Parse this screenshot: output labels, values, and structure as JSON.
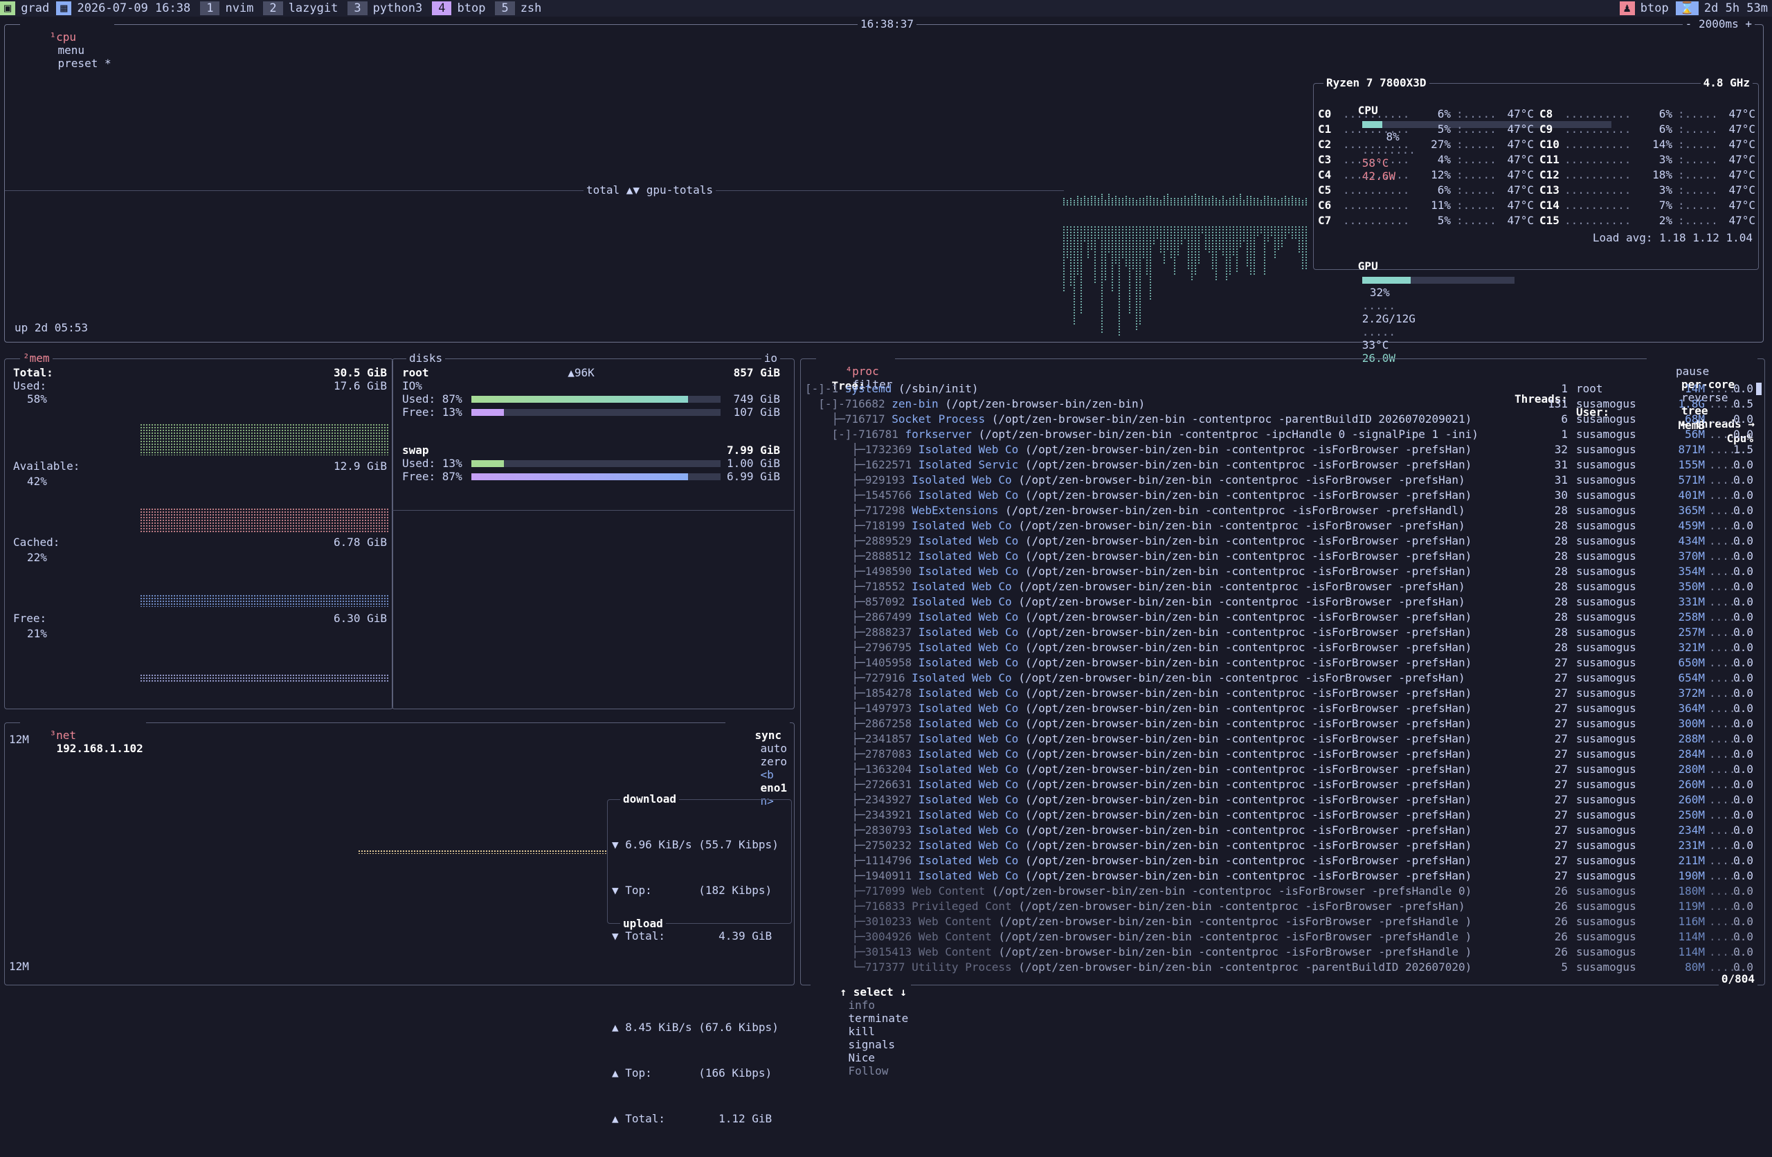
{
  "topbar": {
    "host": "grad",
    "datetime": "2026-07-09 16:38",
    "workspaces": [
      {
        "num": "1",
        "name": "nvim"
      },
      {
        "num": "2",
        "name": "lazygit"
      },
      {
        "num": "3",
        "name": "python3"
      },
      {
        "num": "4",
        "name": "btop"
      },
      {
        "num": "5",
        "name": "zsh"
      }
    ],
    "active_app": "btop",
    "uptime": "2d 5h 53m"
  },
  "cpu_panel": {
    "title": "¹cpu",
    "menu": "menu",
    "preset": "preset *",
    "clock": "16:38:37",
    "interval": "- 2000ms +",
    "graph_label": "total ▲▼ gpu-totals",
    "uptime": "up 2d 05:53",
    "model": "Ryzen 7 7800X3D",
    "freq": "4.8 GHz",
    "cpu_total": {
      "label": "CPU",
      "pct": "8%",
      "temp": "58°C",
      "power": "42.6W",
      "value": 0.08
    },
    "cores_left": [
      {
        "id": "C0",
        "pct": "6%",
        "temp": "47°C"
      },
      {
        "id": "C1",
        "pct": "5%",
        "temp": "47°C"
      },
      {
        "id": "C2",
        "pct": "27%",
        "temp": "47°C"
      },
      {
        "id": "C3",
        "pct": "4%",
        "temp": "47°C"
      },
      {
        "id": "C4",
        "pct": "12%",
        "temp": "47°C"
      },
      {
        "id": "C5",
        "pct": "6%",
        "temp": "47°C"
      },
      {
        "id": "C6",
        "pct": "11%",
        "temp": "47°C"
      },
      {
        "id": "C7",
        "pct": "5%",
        "temp": "47°C"
      }
    ],
    "cores_right": [
      {
        "id": "C8",
        "pct": "6%",
        "temp": "47°C"
      },
      {
        "id": "C9",
        "pct": "6%",
        "temp": "47°C"
      },
      {
        "id": "C10",
        "pct": "14%",
        "temp": "47°C"
      },
      {
        "id": "C11",
        "pct": "3%",
        "temp": "47°C"
      },
      {
        "id": "C12",
        "pct": "18%",
        "temp": "47°C"
      },
      {
        "id": "C13",
        "pct": "3%",
        "temp": "47°C"
      },
      {
        "id": "C14",
        "pct": "7%",
        "temp": "47°C"
      },
      {
        "id": "C15",
        "pct": "2%",
        "temp": "47°C"
      }
    ],
    "load_avg": "Load avg: 1.18 1.12 1.04",
    "gpu": {
      "label": "GPU",
      "pct": "32%",
      "mem": "2.2G/12G",
      "temp": "33°C",
      "power": "26.0W",
      "value": 0.32
    }
  },
  "mem_panel": {
    "title": "²mem",
    "total_label": "Total:",
    "total": "30.5 GiB",
    "used_label": "Used:",
    "used": "17.6 GiB",
    "used_pct": "58%",
    "avail_label": "Available:",
    "avail": "12.9 GiB",
    "avail_pct": "42%",
    "cached_label": "Cached:",
    "cached": "6.78 GiB",
    "cached_pct": "22%",
    "free_label": "Free:",
    "free": "6.30 GiB",
    "free_pct": "21%"
  },
  "disks_panel": {
    "title": "disks",
    "io_btn": "io",
    "root": {
      "name": "root",
      "speed": "▲96K",
      "size": "857 GiB",
      "io": "IO%",
      "used_label": "Used: 87%",
      "used": "749 GiB",
      "used_value": 0.87,
      "free_label": "Free: 13%",
      "free": "107 GiB",
      "free_value": 0.13
    },
    "swap": {
      "name": "swap",
      "size": "7.99 GiB",
      "used_label": "Used: 13%",
      "used": "1.00 GiB",
      "used_value": 0.13,
      "free_label": "Free: 87%",
      "free": "6.99 GiB",
      "free_value": 0.87
    }
  },
  "net_panel": {
    "title": "³net",
    "ip": "192.168.1.102",
    "sync": "sync",
    "auto": "auto",
    "zero": "zero",
    "prev": "<b",
    "iface": "eno1",
    "next": "n>",
    "scale_top": "12M",
    "scale_bottom": "12M",
    "download_label": "download",
    "dl_rate": "▼ 6.96 KiB/s (55.7 Kibps)",
    "dl_top": "▼ Top:       (182 Kibps)",
    "dl_total": "▼ Total:        4.39 GiB",
    "ul_rate": "▲ 8.45 KiB/s (67.6 Kibps)",
    "ul_top": "▲ Top:       (166 Kibps)",
    "ul_total": "▲ Total:        1.12 GiB",
    "upload_label": "upload"
  },
  "proc_panel": {
    "title": "⁴proc",
    "filter": "filter",
    "pause": "pause",
    "per_core": "per-core",
    "reverse": "reverse",
    "tree": "tree",
    "threads_btn": "← threads →",
    "col_tree": "Tree:",
    "col_threads": "Threads:",
    "col_user": "User:",
    "col_mem": "MemB",
    "col_cpu": "Cpu%",
    "footer_select": "↑ select ↓",
    "footer_info": "info",
    "footer_terminate": "terminate",
    "footer_kill": "kill",
    "footer_signals": "signals",
    "footer_nice": "Nice",
    "footer_follow": "Follow",
    "count": "0/804",
    "rows": [
      {
        "prefix": "[-]-1 ",
        "name": "systemd",
        "cmd": " (/sbin/init)",
        "threads": "1",
        "user": "root",
        "mem": "14M",
        "cpu": "0.0"
      },
      {
        "prefix": "  [-]-716682 ",
        "name": "zen-bin",
        "cmd": " (/opt/zen-browser-bin/zen-bin)",
        "threads": "131",
        "user": "susamogus",
        "mem": "1.8G",
        "cpu": "0.5"
      },
      {
        "prefix": "    ├─716717 ",
        "name": "Socket Process",
        "cmd": " (/opt/zen-browser-bin/zen-bin -contentproc -parentBuildID 2026070209021)",
        "threads": "6",
        "user": "susamogus",
        "mem": "68M",
        "cpu": "0.0"
      },
      {
        "prefix": "    [-]-716781 ",
        "name": "forkserver",
        "cmd": " (/opt/zen-browser-bin/zen-bin -contentproc -ipcHandle 0 -signalPipe 1 -ini)",
        "threads": "1",
        "user": "susamogus",
        "mem": "56M",
        "cpu": "0.0"
      },
      {
        "prefix": "       ├─1732369 ",
        "name": "Isolated Web Co",
        "cmd": " (/opt/zen-browser-bin/zen-bin -contentproc -isForBrowser -prefsHan)",
        "threads": "32",
        "user": "susamogus",
        "mem": "871M",
        "cpu": "1.5"
      },
      {
        "prefix": "       ├─1622571 ",
        "name": "Isolated Servic",
        "cmd": " (/opt/zen-browser-bin/zen-bin -contentproc -isForBrowser -prefsHan)",
        "threads": "31",
        "user": "susamogus",
        "mem": "155M",
        "cpu": "0.0"
      },
      {
        "prefix": "       ├─929193 ",
        "name": "Isolated Web Co",
        "cmd": " (/opt/zen-browser-bin/zen-bin -contentproc -isForBrowser -prefsHan)",
        "threads": "31",
        "user": "susamogus",
        "mem": "571M",
        "cpu": "0.0"
      },
      {
        "prefix": "       ├─1545766 ",
        "name": "Isolated Web Co",
        "cmd": " (/opt/zen-browser-bin/zen-bin -contentproc -isForBrowser -prefsHan)",
        "threads": "30",
        "user": "susamogus",
        "mem": "401M",
        "cpu": "0.0"
      },
      {
        "prefix": "       ├─717298 ",
        "name": "WebExtensions",
        "cmd": " (/opt/zen-browser-bin/zen-bin -contentproc -isForBrowser -prefsHandl)",
        "threads": "28",
        "user": "susamogus",
        "mem": "365M",
        "cpu": "0.0"
      },
      {
        "prefix": "       ├─718199 ",
        "name": "Isolated Web Co",
        "cmd": " (/opt/zen-browser-bin/zen-bin -contentproc -isForBrowser -prefsHan)",
        "threads": "28",
        "user": "susamogus",
        "mem": "459M",
        "cpu": "0.0"
      },
      {
        "prefix": "       ├─2889529 ",
        "name": "Isolated Web Co",
        "cmd": " (/opt/zen-browser-bin/zen-bin -contentproc -isForBrowser -prefsHan)",
        "threads": "28",
        "user": "susamogus",
        "mem": "434M",
        "cpu": "0.0"
      },
      {
        "prefix": "       ├─2888512 ",
        "name": "Isolated Web Co",
        "cmd": " (/opt/zen-browser-bin/zen-bin -contentproc -isForBrowser -prefsHan)",
        "threads": "28",
        "user": "susamogus",
        "mem": "370M",
        "cpu": "0.0"
      },
      {
        "prefix": "       ├─1498590 ",
        "name": "Isolated Web Co",
        "cmd": " (/opt/zen-browser-bin/zen-bin -contentproc -isForBrowser -prefsHan)",
        "threads": "28",
        "user": "susamogus",
        "mem": "354M",
        "cpu": "0.0"
      },
      {
        "prefix": "       ├─718552 ",
        "name": "Isolated Web Co",
        "cmd": " (/opt/zen-browser-bin/zen-bin -contentproc -isForBrowser -prefsHan)",
        "threads": "28",
        "user": "susamogus",
        "mem": "350M",
        "cpu": "0.0"
      },
      {
        "prefix": "       ├─857092 ",
        "name": "Isolated Web Co",
        "cmd": " (/opt/zen-browser-bin/zen-bin -contentproc -isForBrowser -prefsHan)",
        "threads": "28",
        "user": "susamogus",
        "mem": "331M",
        "cpu": "0.0"
      },
      {
        "prefix": "       ├─2867499 ",
        "name": "Isolated Web Co",
        "cmd": " (/opt/zen-browser-bin/zen-bin -contentproc -isForBrowser -prefsHan)",
        "threads": "28",
        "user": "susamogus",
        "mem": "258M",
        "cpu": "0.0"
      },
      {
        "prefix": "       ├─2888237 ",
        "name": "Isolated Web Co",
        "cmd": " (/opt/zen-browser-bin/zen-bin -contentproc -isForBrowser -prefsHan)",
        "threads": "28",
        "user": "susamogus",
        "mem": "257M",
        "cpu": "0.0"
      },
      {
        "prefix": "       ├─2796795 ",
        "name": "Isolated Web Co",
        "cmd": " (/opt/zen-browser-bin/zen-bin -contentproc -isForBrowser -prefsHan)",
        "threads": "28",
        "user": "susamogus",
        "mem": "321M",
        "cpu": "0.0"
      },
      {
        "prefix": "       ├─1405958 ",
        "name": "Isolated Web Co",
        "cmd": " (/opt/zen-browser-bin/zen-bin -contentproc -isForBrowser -prefsHan)",
        "threads": "27",
        "user": "susamogus",
        "mem": "650M",
        "cpu": "0.0"
      },
      {
        "prefix": "       ├─727916 ",
        "name": "Isolated Web Co",
        "cmd": " (/opt/zen-browser-bin/zen-bin -contentproc -isForBrowser -prefsHan)",
        "threads": "27",
        "user": "susamogus",
        "mem": "654M",
        "cpu": "0.0"
      },
      {
        "prefix": "       ├─1854278 ",
        "name": "Isolated Web Co",
        "cmd": " (/opt/zen-browser-bin/zen-bin -contentproc -isForBrowser -prefsHan)",
        "threads": "27",
        "user": "susamogus",
        "mem": "372M",
        "cpu": "0.0"
      },
      {
        "prefix": "       ├─1497973 ",
        "name": "Isolated Web Co",
        "cmd": " (/opt/zen-browser-bin/zen-bin -contentproc -isForBrowser -prefsHan)",
        "threads": "27",
        "user": "susamogus",
        "mem": "364M",
        "cpu": "0.0"
      },
      {
        "prefix": "       ├─2867258 ",
        "name": "Isolated Web Co",
        "cmd": " (/opt/zen-browser-bin/zen-bin -contentproc -isForBrowser -prefsHan)",
        "threads": "27",
        "user": "susamogus",
        "mem": "300M",
        "cpu": "0.0"
      },
      {
        "prefix": "       ├─2341857 ",
        "name": "Isolated Web Co",
        "cmd": " (/opt/zen-browser-bin/zen-bin -contentproc -isForBrowser -prefsHan)",
        "threads": "27",
        "user": "susamogus",
        "mem": "288M",
        "cpu": "0.0"
      },
      {
        "prefix": "       ├─2787083 ",
        "name": "Isolated Web Co",
        "cmd": " (/opt/zen-browser-bin/zen-bin -contentproc -isForBrowser -prefsHan)",
        "threads": "27",
        "user": "susamogus",
        "mem": "284M",
        "cpu": "0.0"
      },
      {
        "prefix": "       ├─1363204 ",
        "name": "Isolated Web Co",
        "cmd": " (/opt/zen-browser-bin/zen-bin -contentproc -isForBrowser -prefsHan)",
        "threads": "27",
        "user": "susamogus",
        "mem": "280M",
        "cpu": "0.0"
      },
      {
        "prefix": "       ├─2726631 ",
        "name": "Isolated Web Co",
        "cmd": " (/opt/zen-browser-bin/zen-bin -contentproc -isForBrowser -prefsHan)",
        "threads": "27",
        "user": "susamogus",
        "mem": "260M",
        "cpu": "0.0"
      },
      {
        "prefix": "       ├─2343927 ",
        "name": "Isolated Web Co",
        "cmd": " (/opt/zen-browser-bin/zen-bin -contentproc -isForBrowser -prefsHan)",
        "threads": "27",
        "user": "susamogus",
        "mem": "260M",
        "cpu": "0.0"
      },
      {
        "prefix": "       ├─2343921 ",
        "name": "Isolated Web Co",
        "cmd": " (/opt/zen-browser-bin/zen-bin -contentproc -isForBrowser -prefsHan)",
        "threads": "27",
        "user": "susamogus",
        "mem": "250M",
        "cpu": "0.0"
      },
      {
        "prefix": "       ├─2830793 ",
        "name": "Isolated Web Co",
        "cmd": " (/opt/zen-browser-bin/zen-bin -contentproc -isForBrowser -prefsHan)",
        "threads": "27",
        "user": "susamogus",
        "mem": "234M",
        "cpu": "0.0"
      },
      {
        "prefix": "       ├─2750232 ",
        "name": "Isolated Web Co",
        "cmd": " (/opt/zen-browser-bin/zen-bin -contentproc -isForBrowser -prefsHan)",
        "threads": "27",
        "user": "susamogus",
        "mem": "231M",
        "cpu": "0.0"
      },
      {
        "prefix": "       ├─1114796 ",
        "name": "Isolated Web Co",
        "cmd": " (/opt/zen-browser-bin/zen-bin -contentproc -isForBrowser -prefsHan)",
        "threads": "27",
        "user": "susamogus",
        "mem": "211M",
        "cpu": "0.0"
      },
      {
        "prefix": "       ├─1940911 ",
        "name": "Isolated Web Co",
        "cmd": " (/opt/zen-browser-bin/zen-bin -contentproc -isForBrowser -prefsHan)",
        "threads": "27",
        "user": "susamogus",
        "mem": "190M",
        "cpu": "0.0"
      },
      {
        "prefix": "       ├─717099 ",
        "name": "Web Content",
        "cmd": " (/opt/zen-browser-bin/zen-bin -contentproc -isForBrowser -prefsHandle 0)",
        "threads": "26",
        "user": "susamogus",
        "mem": "180M",
        "cpu": "0.0",
        "dim": true
      },
      {
        "prefix": "       ├─716833 ",
        "name": "Privileged Cont",
        "cmd": " (/opt/zen-browser-bin/zen-bin -contentproc -isForBrowser -prefsHan)",
        "threads": "26",
        "user": "susamogus",
        "mem": "119M",
        "cpu": "0.0",
        "dim": true
      },
      {
        "prefix": "       ├─3010233 ",
        "name": "Web Content",
        "cmd": " (/opt/zen-browser-bin/zen-bin -contentproc -isForBrowser -prefsHandle )",
        "threads": "26",
        "user": "susamogus",
        "mem": "116M",
        "cpu": "0.0",
        "dim": true
      },
      {
        "prefix": "       ├─3004926 ",
        "name": "Web Content",
        "cmd": " (/opt/zen-browser-bin/zen-bin -contentproc -isForBrowser -prefsHandle )",
        "threads": "26",
        "user": "susamogus",
        "mem": "114M",
        "cpu": "0.0",
        "dim": true
      },
      {
        "prefix": "       ├─3015413 ",
        "name": "Web Content",
        "cmd": " (/opt/zen-browser-bin/zen-bin -contentproc -isForBrowser -prefsHandle )",
        "threads": "26",
        "user": "susamogus",
        "mem": "114M",
        "cpu": "0.0",
        "dim": true
      },
      {
        "prefix": "       └─717377 ",
        "name": "Utility Process",
        "cmd": " (/opt/zen-browser-bin/zen-bin -contentproc -parentBuildID 202607020)",
        "threads": "5",
        "user": "susamogus",
        "mem": "80M",
        "cpu": "0.0",
        "dim": true
      }
    ]
  },
  "colors": {
    "bg": "#181926",
    "border": "#5b6078",
    "accent": "#c6a0f6",
    "cpu_graph": "#8bd5ca",
    "swap_free": "#c6a0f6",
    "disk_used": "#a6da95",
    "net_graph": "#eed49f"
  }
}
